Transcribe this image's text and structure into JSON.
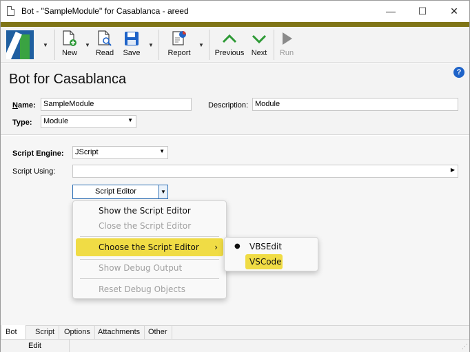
{
  "window": {
    "title": "Bot - \"SampleModule\" for Casablanca - areed",
    "minimize_glyph": "—",
    "maximize_glyph": "☐",
    "close_glyph": "✕"
  },
  "colors": {
    "accent_bar": "#7f7416",
    "highlight": "#f0dc45",
    "logo_blue": "#1f5fa0",
    "logo_green": "#3aa342"
  },
  "toolbar": {
    "new_label": "New",
    "read_label": "Read",
    "save_label": "Save",
    "report_label": "Report",
    "previous_label": "Previous",
    "next_label": "Next",
    "run_label": "Run",
    "icons": [
      "app-logo-icon",
      "new-document-icon",
      "read-document-icon",
      "save-disk-icon",
      "report-icon",
      "up-chevron-icon",
      "down-chevron-icon",
      "play-icon"
    ]
  },
  "header": {
    "title": "Bot for Casablanca",
    "help_glyph": "?",
    "name_label_u": "N",
    "name_label_rest": "ame:",
    "name_value": "SampleModule",
    "description_label": "Description:",
    "description_value": "Module",
    "type_label": "Type:",
    "type_value": "Module"
  },
  "script": {
    "engine_label": "Script Engine:",
    "engine_value": "JScript",
    "using_label": "Script Using:",
    "using_value": "",
    "editor_button_label": "Script Editor"
  },
  "menu": {
    "items": [
      {
        "label": "Show the Script Editor",
        "enabled": true
      },
      {
        "label": "Close the Script Editor",
        "enabled": false
      },
      {
        "label": "Choose the Script Editor",
        "enabled": true
      },
      {
        "label": "Show Debug Output",
        "enabled": false
      },
      {
        "label": "Reset Debug Objects",
        "enabled": false
      }
    ],
    "submenu_arrow": "›"
  },
  "submenu": {
    "items": [
      {
        "label": "VBSEdit",
        "checked": true
      },
      {
        "label": "VSCode",
        "checked": false
      }
    ]
  },
  "tabs": [
    "Bot",
    "Script",
    "Options",
    "Attachments",
    "Other"
  ],
  "status": {
    "mode": "Edit"
  }
}
